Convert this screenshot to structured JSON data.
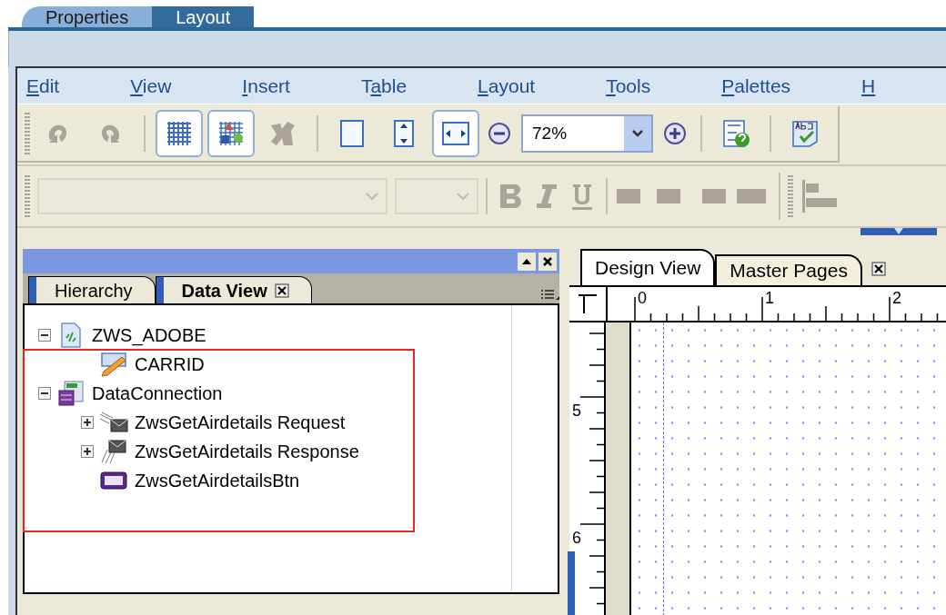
{
  "top_tabs": [
    {
      "label": "Properties",
      "selected": false
    },
    {
      "label": "Layout",
      "selected": true
    }
  ],
  "menu": [
    {
      "key": "E",
      "after": "dit"
    },
    {
      "key": "V",
      "after": "iew"
    },
    {
      "key": "I",
      "after": "nsert"
    },
    {
      "before": "T",
      "key": "a",
      "after": "ble"
    },
    {
      "key": "L",
      "after": "ayout"
    },
    {
      "key": "T",
      "after": "ools"
    },
    {
      "key": "P",
      "after": "alettes"
    },
    {
      "key": "H"
    }
  ],
  "toolbar": [
    {
      "kind": "undo",
      "disabled": true,
      "pressed": false
    },
    {
      "kind": "redo",
      "disabled": true,
      "pressed": false
    },
    {
      "kind": "separator"
    },
    {
      "kind": "grid",
      "disabled": false,
      "pressed": true
    },
    {
      "kind": "snap",
      "disabled": false,
      "pressed": true
    },
    {
      "kind": "tools",
      "disabled": true,
      "pressed": false
    },
    {
      "kind": "separator"
    },
    {
      "kind": "page",
      "disabled": false,
      "pressed": false
    },
    {
      "kind": "fit-height",
      "disabled": false,
      "pressed": false
    },
    {
      "kind": "fit-width",
      "disabled": false,
      "pressed": true
    },
    {
      "kind": "zoom-out",
      "disabled": false,
      "pressed": false
    },
    {
      "kind": "zoom-field",
      "value": "72%"
    },
    {
      "kind": "zoom-in",
      "disabled": false,
      "pressed": false
    },
    {
      "kind": "separator"
    },
    {
      "kind": "list-help",
      "disabled": false,
      "pressed": false
    },
    {
      "kind": "separator"
    },
    {
      "kind": "spell",
      "disabled": false,
      "pressed": false
    }
  ],
  "format_toolbar": {
    "disabled": true
  },
  "data_panel": {
    "tabs": [
      {
        "label": "Hierarchy",
        "selected": false,
        "closable": false
      },
      {
        "label": "Data View",
        "selected": true,
        "closable": true
      }
    ],
    "tree": [
      {
        "label": "ZWS_ADOBE",
        "kind": "schema",
        "expanded": true,
        "children": [
          {
            "label": "CARRID",
            "kind": "field"
          }
        ]
      },
      {
        "label": "DataConnection",
        "kind": "connection",
        "expanded": true,
        "children": [
          {
            "label": "ZwsGetAirdetails Request",
            "kind": "request",
            "expanded": false
          },
          {
            "label": "ZwsGetAirdetails Response",
            "kind": "response",
            "expanded": false
          },
          {
            "label": "ZwsGetAirdetailsBtn",
            "kind": "button"
          }
        ]
      }
    ]
  },
  "design": {
    "tabs": [
      {
        "label": "Design View",
        "selected": true
      },
      {
        "label": "Master Pages",
        "selected": false
      }
    ],
    "top_ruler": [
      "0",
      "1",
      "2"
    ],
    "left_ruler": [
      "5",
      "6"
    ]
  }
}
